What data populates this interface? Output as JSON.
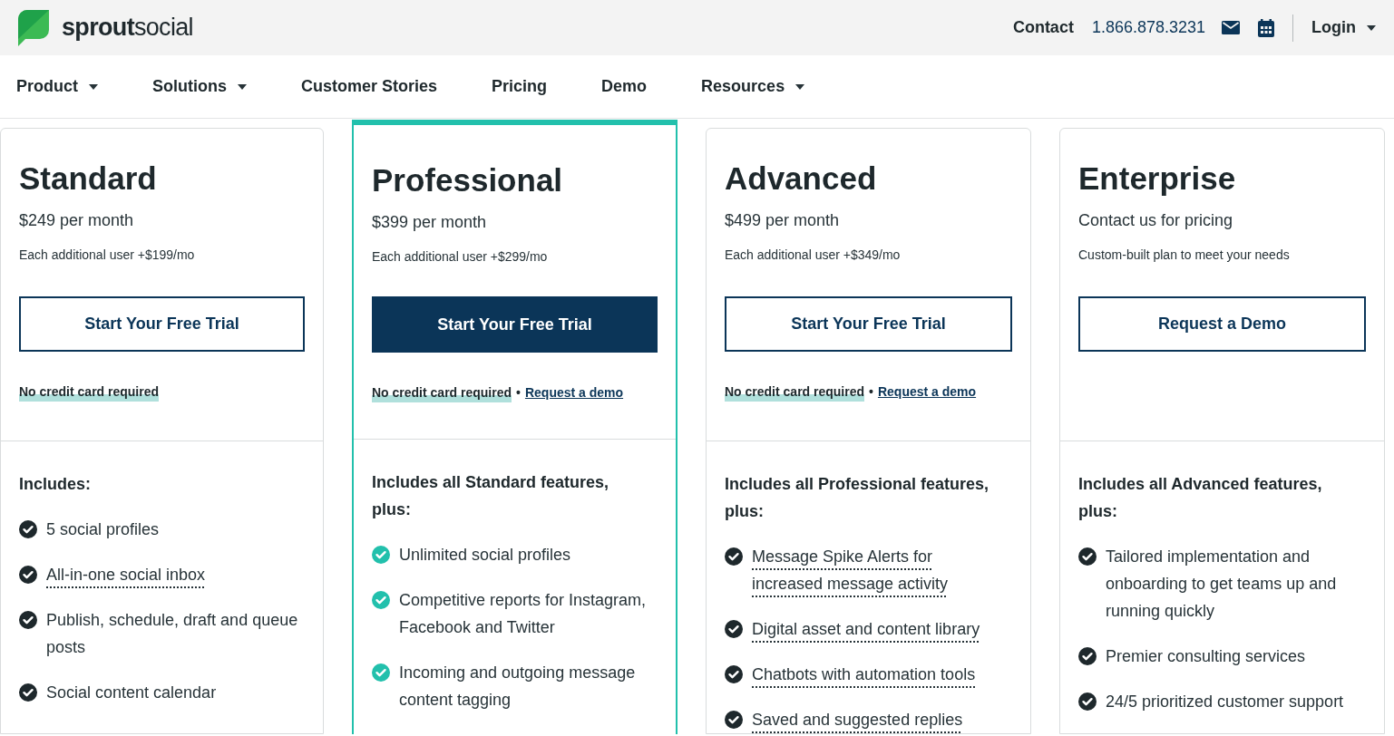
{
  "header": {
    "logo_bold": "sprout",
    "logo_light": "social",
    "contact": "Contact",
    "phone": "1.866.878.3231",
    "login": "Login"
  },
  "nav": [
    {
      "label": "Product",
      "dropdown": true
    },
    {
      "label": "Solutions",
      "dropdown": true
    },
    {
      "label": "Customer Stories",
      "dropdown": false
    },
    {
      "label": "Pricing",
      "dropdown": false
    },
    {
      "label": "Demo",
      "dropdown": false
    },
    {
      "label": "Resources",
      "dropdown": true
    }
  ],
  "plans": [
    {
      "name": "Standard",
      "price": "$249 per month",
      "extra": "Each additional user +$199/mo",
      "featured": false,
      "cta": "Start Your Free Trial",
      "note": "No credit card required",
      "includes": "Includes:",
      "features": [
        {
          "text": "5 social profiles",
          "tooltip": false
        },
        {
          "text": "All-in-one social inbox",
          "tooltip": true
        },
        {
          "text": "Publish, schedule, draft and queue posts",
          "tooltip": false
        },
        {
          "text": "Social content calendar",
          "tooltip": false
        }
      ]
    },
    {
      "name": "Professional",
      "price": "$399 per month",
      "extra": "Each additional user +$299/mo",
      "featured": true,
      "cta": "Start Your Free Trial",
      "note": "No credit card required",
      "separator": "•",
      "demo_link": "Request a demo",
      "includes": "Includes all Standard features, plus:",
      "features": [
        {
          "text": "Unlimited social profiles",
          "tooltip": false
        },
        {
          "text": "Competitive reports for Instagram, Facebook and Twitter",
          "tooltip": false
        },
        {
          "text": "Incoming and outgoing message content tagging",
          "tooltip": false
        }
      ]
    },
    {
      "name": "Advanced",
      "price": "$499 per month",
      "extra": "Each additional user +$349/mo",
      "featured": false,
      "cta": "Start Your Free Trial",
      "note": "No credit card required",
      "separator": "•",
      "demo_link": "Request a demo",
      "includes": "Includes all Professional features, plus:",
      "features": [
        {
          "text": "Message Spike Alerts for increased message activity",
          "tooltip": true
        },
        {
          "text": "Digital asset and content library",
          "tooltip": true
        },
        {
          "text": "Chatbots with automation tools",
          "tooltip": true
        },
        {
          "text": "Saved and suggested replies",
          "tooltip": true
        }
      ]
    },
    {
      "name": "Enterprise",
      "price": "Contact us for pricing",
      "extra": "Custom-built plan to meet your needs",
      "featured": false,
      "cta": "Request a Demo",
      "includes": "Includes all Advanced features, plus:",
      "features": [
        {
          "text": "Tailored implementation and onboarding to get teams up and running quickly",
          "tooltip": false
        },
        {
          "text": "Premier consulting services",
          "tooltip": false
        },
        {
          "text": "24/5 prioritized customer support",
          "tooltip": false
        }
      ]
    }
  ]
}
